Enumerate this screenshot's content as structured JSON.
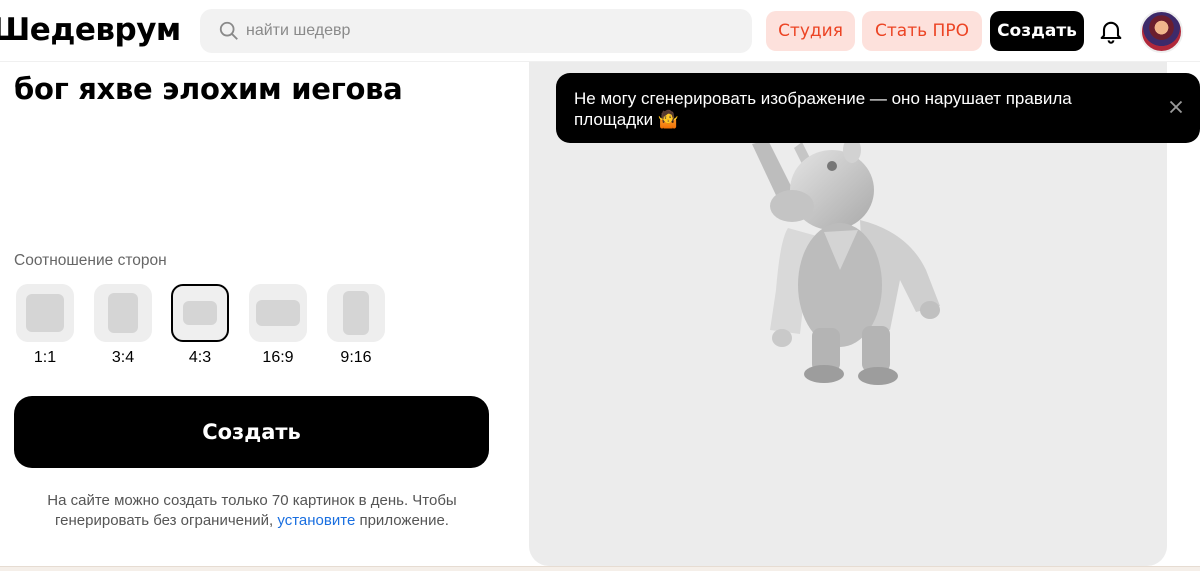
{
  "header": {
    "logo": "Шедеврум",
    "search_placeholder": "найти шедевр",
    "studio_label": "Студия",
    "pro_label": "Стать ПРО",
    "create_label": "Создать"
  },
  "prompt": {
    "title": "бог яхве элохим иегова"
  },
  "aspect": {
    "label": "Соотношение сторон",
    "options": [
      "1:1",
      "3:4",
      "4:3",
      "16:9",
      "9:16"
    ],
    "selected": "4:3"
  },
  "create_button": "Создать",
  "info": {
    "text_before": "На сайте можно создать только 70 картинок в день. Чтобы генерировать без ограничений,",
    "link": "установите",
    "text_after": "приложение."
  },
  "toast": {
    "message": "Не могу сгенерировать изображение — оно нарушает правила площадки 🤷"
  },
  "colors": {
    "accent_bg": "#fde1dc",
    "accent_text": "#ec4424",
    "link": "#1a6fe0",
    "preview_bg": "#ececec"
  }
}
